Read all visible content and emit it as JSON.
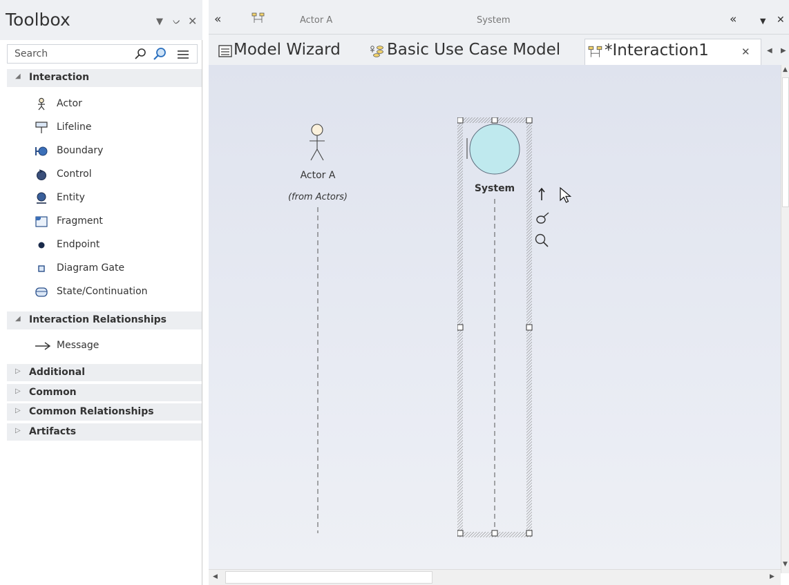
{
  "toolbox": {
    "title": "Toolbox",
    "search_placeholder": "Search",
    "groups": [
      {
        "label": "Interaction",
        "expanded": true,
        "items": [
          {
            "label": "Actor",
            "icon": "actor-icon"
          },
          {
            "label": "Lifeline",
            "icon": "lifeline-icon"
          },
          {
            "label": "Boundary",
            "icon": "boundary-icon"
          },
          {
            "label": "Control",
            "icon": "control-icon"
          },
          {
            "label": "Entity",
            "icon": "entity-icon"
          },
          {
            "label": "Fragment",
            "icon": "fragment-icon"
          },
          {
            "label": "Endpoint",
            "icon": "endpoint-icon"
          },
          {
            "label": "Diagram Gate",
            "icon": "diagram-gate-icon"
          },
          {
            "label": "State/Continuation",
            "icon": "state-continuation-icon"
          }
        ]
      },
      {
        "label": "Interaction Relationships",
        "expanded": true,
        "items": [
          {
            "label": "Message",
            "icon": "message-arrow-icon"
          }
        ]
      },
      {
        "label": "Additional",
        "expanded": false
      },
      {
        "label": "Common",
        "expanded": false
      },
      {
        "label": "Common Relationships",
        "expanded": false
      },
      {
        "label": "Artifacts",
        "expanded": false
      }
    ]
  },
  "breadcrumb": {
    "left": "Actor A",
    "center": "System"
  },
  "tabs": [
    {
      "label": "Model Wizard",
      "icon": "model-wizard-icon",
      "active": false
    },
    {
      "label": "Basic Use Case Model",
      "icon": "use-case-model-icon",
      "active": false
    },
    {
      "label": "*Interaction1",
      "icon": "interaction-diagram-icon",
      "active": true
    }
  ],
  "diagram": {
    "actor": {
      "name": "Actor A",
      "note": "(from Actors)"
    },
    "boundary": {
      "name": "System"
    }
  },
  "colors": {
    "panel_bg": "#eef0f3",
    "canvas_top": "#dfe3ee",
    "boundary_fill": "#bfe9ee",
    "actor_head": "#fbf1dc"
  }
}
